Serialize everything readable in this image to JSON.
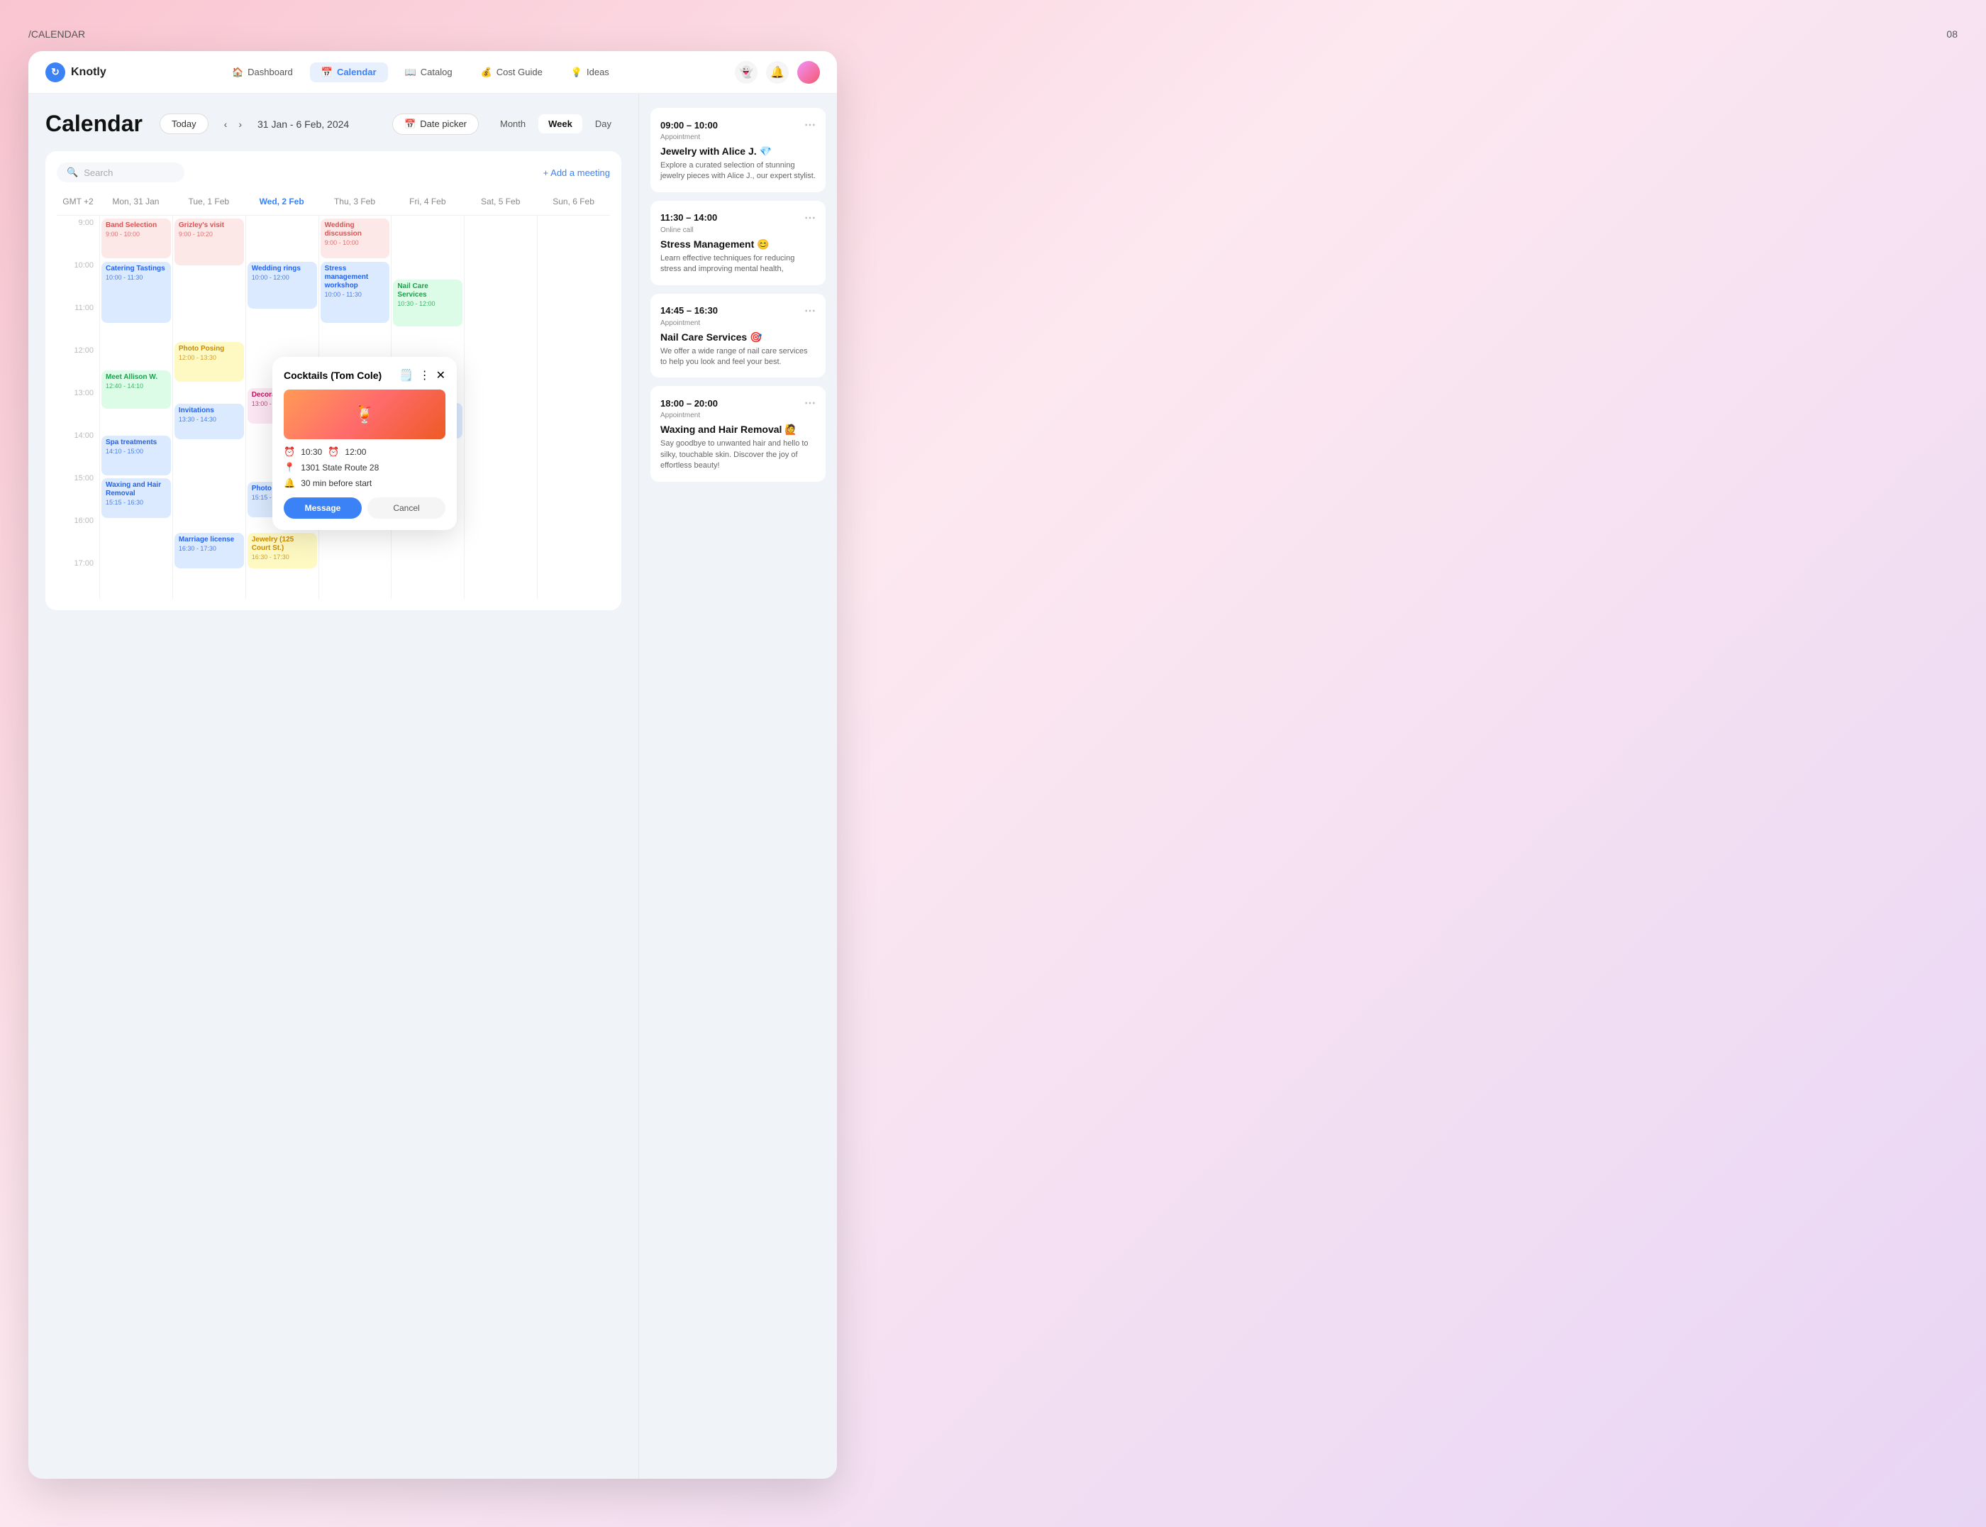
{
  "page": {
    "label": "/CALENDAR",
    "number": "08"
  },
  "nav": {
    "brand": "Knotly",
    "links": [
      {
        "id": "dashboard",
        "label": "Dashboard",
        "icon": "🏠",
        "active": false
      },
      {
        "id": "calendar",
        "label": "Calendar",
        "icon": "📅",
        "active": true
      },
      {
        "id": "catalog",
        "label": "Catalog",
        "icon": "📖",
        "active": false
      },
      {
        "id": "cost-guide",
        "label": "Cost Guide",
        "icon": "💰",
        "active": false
      },
      {
        "id": "ideas",
        "label": "Ideas",
        "icon": "💡",
        "active": false
      }
    ]
  },
  "calendar": {
    "title": "Calendar",
    "today_label": "Today",
    "date_range": "31 Jan - 6 Feb, 2024",
    "date_picker_label": "Date picker",
    "view_tabs": [
      "Month",
      "Week",
      "Day"
    ],
    "active_view": "Week",
    "search_placeholder": "Search",
    "add_meeting_label": "+ Add a meeting",
    "gmt_label": "GMT +2",
    "days": [
      {
        "name": "Mon, 31 Jan",
        "short": "Mon",
        "num": "31 Jan",
        "today": false
      },
      {
        "name": "Tue, 1 Feb",
        "short": "Tue",
        "num": "1 Feb",
        "today": false
      },
      {
        "name": "Wed, 2 Feb",
        "short": "Wed",
        "num": "2 Feb",
        "today": true
      },
      {
        "name": "Thu, 3 Feb",
        "short": "Thu",
        "num": "3 Feb",
        "today": false
      },
      {
        "name": "Fri, 4 Feb",
        "short": "Fri",
        "num": "4 Feb",
        "today": false
      },
      {
        "name": "Sat, 5 Feb",
        "short": "Sat",
        "num": "5 Feb",
        "today": false
      },
      {
        "name": "Sun, 6 Feb",
        "short": "Sun",
        "num": "6 Feb",
        "today": false
      }
    ],
    "times": [
      "9:00",
      "10:00",
      "11:00",
      "12:00",
      "13:00",
      "14:00",
      "15:00",
      "16:00",
      "17:00"
    ]
  },
  "popup": {
    "title": "Cocktails (Tom Cole)",
    "time_start": "10:30",
    "time_end": "12:00",
    "location": "1301 State Route 28",
    "reminder": "30 min before start",
    "message_label": "Message",
    "cancel_label": "Cancel"
  },
  "right_panel": {
    "events": [
      {
        "time": "09:00 – 10:00",
        "type": "Appointment",
        "title": "Jewelry with Alice J. 💎",
        "desc": "Explore a curated selection of stunning jewelry pieces with Alice J., our expert stylist."
      },
      {
        "time": "11:30 – 14:00",
        "type": "Online call",
        "title": "Stress Management 😊",
        "desc": "Learn effective techniques for reducing stress and improving mental health,"
      },
      {
        "time": "14:45 – 16:30",
        "type": "Appointment",
        "title": "Nail Care Services 🎯",
        "desc": "We offer a wide range of nail care services to help you look and feel your best."
      },
      {
        "time": "18:00 – 20:00",
        "type": "Appointment",
        "title": "Waxing and Hair Removal 🙋",
        "desc": "Say goodbye to unwanted hair and hello to silky, touchable skin. Discover the joy of effortless beauty!"
      }
    ]
  }
}
